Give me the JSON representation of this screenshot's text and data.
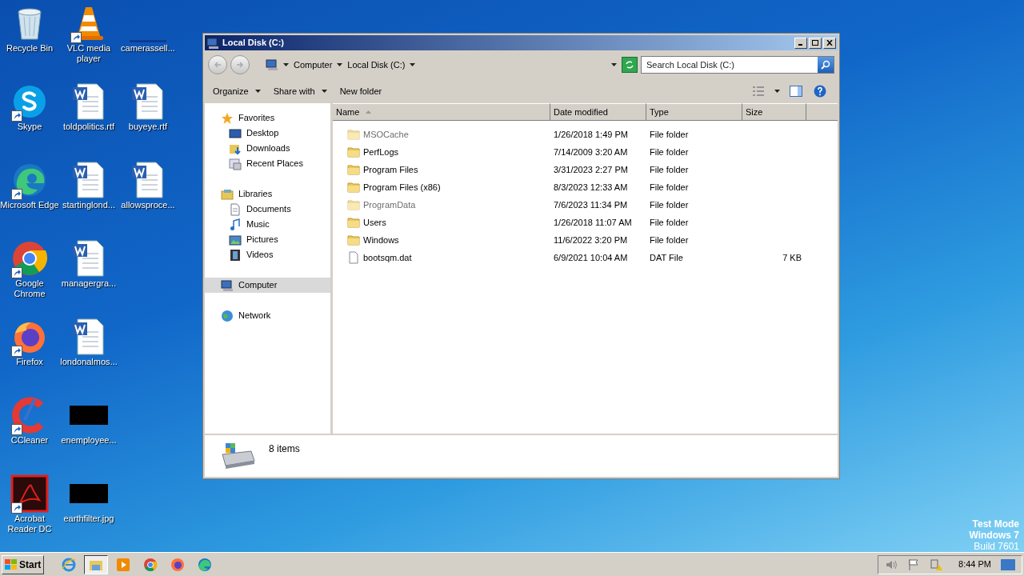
{
  "desktop": {
    "icons": [
      {
        "label": "Recycle Bin",
        "kind": "recycle",
        "shortcut": false
      },
      {
        "label": "Skype",
        "kind": "skype",
        "shortcut": true
      },
      {
        "label": "Microsoft Edge",
        "kind": "edge",
        "shortcut": true
      },
      {
        "label": "Google Chrome",
        "kind": "chrome",
        "shortcut": true
      },
      {
        "label": "Firefox",
        "kind": "firefox",
        "shortcut": true
      },
      {
        "label": "CCleaner",
        "kind": "ccleaner",
        "shortcut": true
      },
      {
        "label": "Acrobat Reader DC",
        "kind": "acrobat",
        "shortcut": true
      },
      {
        "label": "VLC media player",
        "kind": "vlc",
        "shortcut": true
      },
      {
        "label": "toldpolitics.rtf",
        "kind": "word",
        "shortcut": false
      },
      {
        "label": "startinglond...",
        "kind": "word",
        "shortcut": false
      },
      {
        "label": "managergra...",
        "kind": "word",
        "shortcut": false
      },
      {
        "label": "londonalmos...",
        "kind": "word",
        "shortcut": false
      },
      {
        "label": "enemployee...",
        "kind": "image",
        "shortcut": false
      },
      {
        "label": "earthfilter.jpg",
        "kind": "image",
        "shortcut": false
      },
      {
        "label": "camerassell...",
        "kind": "blank",
        "shortcut": false
      },
      {
        "label": "buyeye.rtf",
        "kind": "word",
        "shortcut": false
      },
      {
        "label": "allowsproce...",
        "kind": "word",
        "shortcut": false
      }
    ]
  },
  "window": {
    "title": "Local Disk (C:)",
    "breadcrumb": [
      "Computer",
      "Local Disk (C:)"
    ],
    "search": {
      "placeholder": "Search Local Disk (C:)"
    },
    "toolbar": [
      {
        "label": "Organize",
        "menu": true
      },
      {
        "label": "Share with",
        "menu": true
      },
      {
        "label": "New folder",
        "menu": false
      }
    ],
    "navigation": [
      {
        "label": "Favorites",
        "kind": "favorites",
        "selected": false,
        "children": [
          {
            "label": "Desktop",
            "kind": "desktop",
            "selected": false
          },
          {
            "label": "Downloads",
            "kind": "downloads",
            "selected": false
          },
          {
            "label": "Recent Places",
            "kind": "recent",
            "selected": false
          }
        ]
      },
      {
        "label": "Libraries",
        "kind": "libraries",
        "selected": false,
        "children": [
          {
            "label": "Documents",
            "kind": "documents",
            "selected": false
          },
          {
            "label": "Music",
            "kind": "music",
            "selected": false
          },
          {
            "label": "Pictures",
            "kind": "pictures",
            "selected": false
          },
          {
            "label": "Videos",
            "kind": "videos",
            "selected": false
          }
        ]
      },
      {
        "label": "Computer",
        "kind": "computer",
        "selected": true
      },
      {
        "label": "Network",
        "kind": "network",
        "selected": false
      }
    ],
    "columns": [
      {
        "label": "Name",
        "sorted": true
      },
      {
        "label": "Date modified",
        "sorted": false
      },
      {
        "label": "Type",
        "sorted": false
      },
      {
        "label": "Size",
        "sorted": false
      }
    ],
    "rows": [
      {
        "name": "MSOCache",
        "date": "1/26/2018 1:49 PM",
        "type": "File folder",
        "kind": "folder",
        "hidden": true
      },
      {
        "name": "PerfLogs",
        "date": "7/14/2009 3:20 AM",
        "type": "File folder",
        "kind": "folder",
        "hidden": false
      },
      {
        "name": "Program Files",
        "date": "3/31/2023 2:27 PM",
        "type": "File folder",
        "kind": "folder",
        "hidden": false
      },
      {
        "name": "Program Files (x86)",
        "date": "8/3/2023 12:33 AM",
        "type": "File folder",
        "kind": "folder",
        "hidden": false
      },
      {
        "name": "ProgramData",
        "date": "7/6/2023 11:34 PM",
        "type": "File folder",
        "kind": "folder",
        "hidden": true
      },
      {
        "name": "Users",
        "date": "1/26/2018 11:07 AM",
        "type": "File folder",
        "kind": "folder",
        "hidden": false
      },
      {
        "name": "Windows",
        "date": "11/6/2022 3:20 PM",
        "type": "File folder",
        "kind": "folder",
        "hidden": false
      },
      {
        "name": "bootsqm.dat",
        "date": "6/9/2021 10:04 AM",
        "type": "DAT File",
        "size": "7 KB",
        "kind": "file",
        "hidden": false
      }
    ],
    "status": "8 items"
  },
  "watermark_text": [
    "Test Mode",
    "Windows 7",
    "Build 7601"
  ],
  "taskbar": {
    "start": "Start",
    "apps": [
      {
        "kind": "ie",
        "active": false
      },
      {
        "kind": "explorer",
        "active": true
      },
      {
        "kind": "media",
        "active": false
      },
      {
        "kind": "chrome",
        "active": false
      },
      {
        "kind": "firefox",
        "active": false
      },
      {
        "kind": "edge",
        "active": false
      }
    ],
    "clock": "8:44 PM"
  }
}
